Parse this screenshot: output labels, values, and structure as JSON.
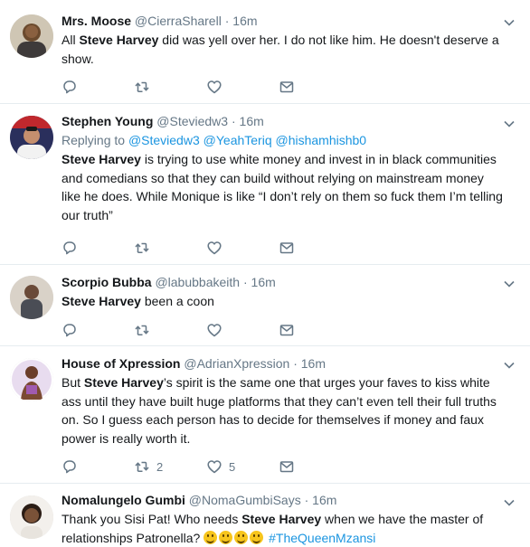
{
  "tweets": [
    {
      "name": "Mrs. Moose",
      "handle": "@CierraSharell",
      "sep": "·",
      "time": "16m",
      "reply_prefix": "",
      "reply_mentions": [],
      "text_parts": [
        {
          "t": "All ",
          "b": false
        },
        {
          "t": "Steve Harvey",
          "b": true
        },
        {
          "t": " did was yell over her. I do not like him. He doesn't deserve a show.",
          "b": false
        }
      ],
      "retweets": "",
      "likes": ""
    },
    {
      "name": "Stephen Young",
      "handle": "@Steviedw3",
      "sep": "·",
      "time": "16m",
      "reply_prefix": "Replying to",
      "reply_mentions": [
        "@Steviedw3",
        "@YeahTeriq",
        "@hishamhishb0"
      ],
      "text_parts": [
        {
          "t": "Steve Harvey",
          "b": true
        },
        {
          "t": " is trying to use white money and invest in in black communities and comedians so that they can build without relying on mainstream money like he does. While Monique is like “I don’t rely on them so fuck them I’m telling our truth”",
          "b": false
        }
      ],
      "retweets": "",
      "likes": ""
    },
    {
      "name": "Scorpio Bubba",
      "handle": "@labubbakeith",
      "sep": "·",
      "time": "16m",
      "reply_prefix": "",
      "reply_mentions": [],
      "text_parts": [
        {
          "t": "Steve Harvey",
          "b": true
        },
        {
          "t": " been a coon",
          "b": false
        }
      ],
      "retweets": "",
      "likes": ""
    },
    {
      "name": "House of Xpression",
      "handle": "@AdrianXpression",
      "sep": "·",
      "time": "16m",
      "reply_prefix": "",
      "reply_mentions": [],
      "text_parts": [
        {
          "t": "But ",
          "b": false
        },
        {
          "t": "Steve Harvey",
          "b": true
        },
        {
          "t": "’s spirit is the same one that urges your faves to kiss white ass until they have built huge platforms that they can’t even tell their full truths on. So I guess each person has to decide for themselves if money and faux power is really worth it.",
          "b": false
        }
      ],
      "retweets": "2",
      "likes": "5"
    },
    {
      "name": "Nomalungelo Gumbi",
      "handle": "@NomaGumbiSays",
      "sep": "·",
      "time": "16m",
      "reply_prefix": "",
      "reply_mentions": [],
      "text_parts": [
        {
          "t": "Thank you Sisi Pat! Who needs ",
          "b": false
        },
        {
          "t": "Steve Harvey",
          "b": true
        },
        {
          "t": " when we have the master of relationships Patronella? ",
          "b": false
        }
      ],
      "emoji_count": 4,
      "hashtag": "#TheQueenMzansi",
      "retweets": "",
      "likes": ""
    }
  ],
  "colors": {
    "text": "#14171a",
    "muted": "#657786",
    "link": "#1b95e0",
    "divider": "#e6ecf0"
  },
  "icons": [
    "reply-icon",
    "retweet-icon",
    "like-icon",
    "dm-icon",
    "caret-down-icon",
    "smiley-emoji"
  ]
}
